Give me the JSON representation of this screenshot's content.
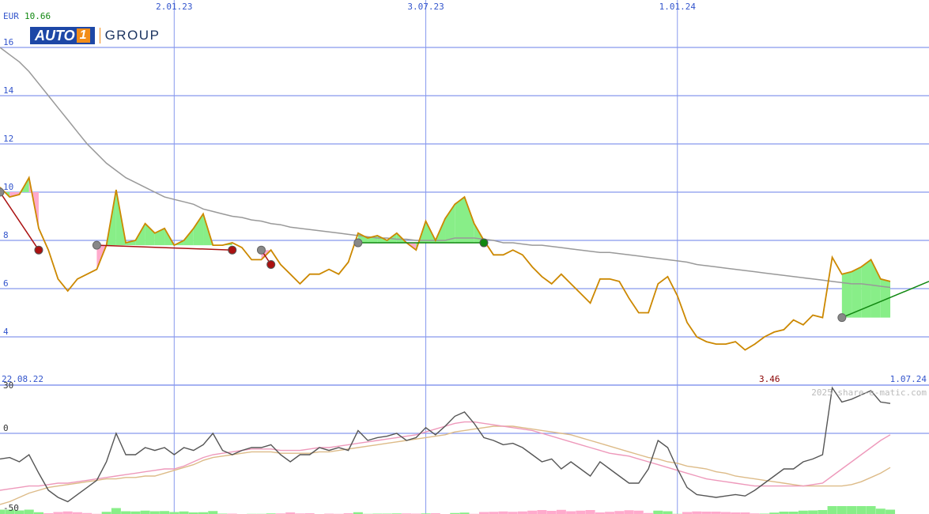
{
  "header": {
    "currency": "EUR",
    "last_price": "10.66"
  },
  "logo": {
    "main": "AUTO",
    "num": "1",
    "group": "GROUP"
  },
  "footer": {
    "start_date": "22.08.22",
    "end_date": "1.07.24",
    "min_label": "3.46",
    "watermark": "2025 share-e-matic.com"
  },
  "colors": {
    "price": "#cc8800",
    "sma": "#999999",
    "grid": "#8899ee",
    "gain": "#88ee88",
    "loss": "#ffaacc",
    "trade_loss": "#aa1111",
    "trade_gain": "#118811",
    "osc": "#555555",
    "osc_sig1": "#ee99bb",
    "osc_sig2": "#ddbb88"
  },
  "chart_data": [
    {
      "type": "line",
      "title": "",
      "ylim": [
        3,
        17
      ],
      "y_ticks": [
        4,
        6,
        8,
        10,
        12,
        14,
        16
      ],
      "x_ticks": [
        {
          "t": 19,
          "label": "2.01.23"
        },
        {
          "t": 45,
          "label": "3.07.23"
        },
        {
          "t": 71,
          "label": "1.01.24"
        }
      ],
      "x_range": [
        1,
        97
      ],
      "grid": true,
      "series": [
        {
          "name": "",
          "role": "price",
          "values": [
            10.2,
            9.8,
            9.9,
            10.6,
            8.5,
            7.6,
            6.4,
            5.9,
            6.4,
            6.6,
            6.8,
            7.8,
            10.1,
            7.9,
            8.0,
            8.7,
            8.3,
            8.5,
            7.8,
            8.0,
            8.5,
            9.1,
            7.8,
            7.8,
            7.9,
            7.7,
            7.2,
            7.2,
            7.6,
            7.0,
            6.6,
            6.2,
            6.6,
            6.6,
            6.8,
            6.6,
            7.1,
            8.3,
            8.1,
            8.2,
            8.0,
            8.3,
            7.9,
            7.6,
            8.8,
            8.0,
            8.9,
            9.5,
            9.8,
            8.7,
            8.0,
            7.4,
            7.4,
            7.6,
            7.4,
            6.9,
            6.5,
            6.2,
            6.6,
            6.2,
            5.8,
            5.4,
            6.4,
            6.4,
            6.3,
            5.6,
            5.0,
            5.0,
            6.2,
            6.5,
            5.7,
            4.6,
            4.0,
            3.8,
            3.7,
            3.7,
            3.8,
            3.46,
            3.7,
            4.0,
            4.2,
            4.3,
            4.7,
            4.5,
            4.9,
            4.8,
            7.3,
            6.6,
            6.7,
            6.9,
            7.2,
            6.4,
            6.3
          ]
        },
        {
          "name": "",
          "role": "sma",
          "values": [
            16.0,
            15.7,
            15.4,
            15.0,
            14.5,
            14.0,
            13.5,
            13.0,
            12.5,
            12.0,
            11.6,
            11.2,
            10.9,
            10.6,
            10.4,
            10.2,
            10.0,
            9.8,
            9.7,
            9.6,
            9.5,
            9.3,
            9.2,
            9.1,
            9.0,
            8.95,
            8.85,
            8.8,
            8.7,
            8.65,
            8.55,
            8.5,
            8.45,
            8.4,
            8.35,
            8.3,
            8.25,
            8.2,
            8.15,
            8.1,
            8.1,
            8.05,
            8.05,
            8.0,
            8.0,
            8.0,
            8.0,
            8.1,
            8.1,
            8.1,
            8.05,
            8.0,
            7.9,
            7.9,
            7.85,
            7.8,
            7.8,
            7.75,
            7.7,
            7.65,
            7.6,
            7.55,
            7.5,
            7.5,
            7.45,
            7.4,
            7.35,
            7.3,
            7.25,
            7.2,
            7.15,
            7.1,
            7.0,
            6.95,
            6.9,
            6.85,
            6.8,
            6.75,
            6.7,
            6.65,
            6.6,
            6.55,
            6.5,
            6.45,
            6.4,
            6.35,
            6.3,
            6.25,
            6.2,
            6.2,
            6.15,
            6.1,
            6.05
          ]
        }
      ],
      "trades": [
        {
          "from": [
            1,
            10.0
          ],
          "to": [
            5,
            7.6
          ],
          "outcome": "loss"
        },
        {
          "from": [
            11,
            7.8
          ],
          "to": [
            25,
            7.6
          ],
          "outcome": "loss"
        },
        {
          "from": [
            28,
            7.6
          ],
          "to": [
            29,
            7.0
          ],
          "outcome": "loss"
        },
        {
          "from": [
            38,
            7.9
          ],
          "to": [
            51,
            7.9
          ],
          "outcome": "gain"
        },
        {
          "from": [
            88,
            4.8
          ],
          "to": [
            97,
            6.3
          ],
          "outcome": "open"
        }
      ]
    },
    {
      "type": "line",
      "title": "",
      "ylim": [
        -52,
        33
      ],
      "y_ticks": [
        -50,
        0,
        30
      ],
      "series": [
        {
          "name": "",
          "role": "oscillator",
          "values": [
            -18,
            -17,
            -20,
            -15,
            -28,
            -40,
            -45,
            -48,
            -43,
            -38,
            -33,
            -20,
            0,
            -15,
            -15,
            -10,
            -12,
            -10,
            -15,
            -10,
            -12,
            -8,
            0,
            -12,
            -15,
            -12,
            -10,
            -10,
            -8,
            -15,
            -20,
            -15,
            -15,
            -10,
            -12,
            -10,
            -12,
            2,
            -5,
            -3,
            -2,
            0,
            -5,
            -3,
            4,
            -1,
            5,
            12,
            15,
            7,
            -3,
            -5,
            -8,
            -7,
            -10,
            -15,
            -20,
            -18,
            -25,
            -20,
            -25,
            -30,
            -20,
            -25,
            -30,
            -35,
            -35,
            -25,
            -5,
            -10,
            -25,
            -38,
            -43,
            -44,
            -45,
            -44,
            -43,
            -44,
            -40,
            -35,
            -30,
            -25,
            -25,
            -20,
            -18,
            -15,
            32,
            22,
            24,
            27,
            30,
            22,
            21
          ]
        },
        {
          "name": "",
          "role": "signal-fast",
          "values": [
            -40,
            -39,
            -38,
            -37,
            -37,
            -36,
            -35,
            -35,
            -34,
            -33,
            -32,
            -31,
            -30,
            -29,
            -28,
            -27,
            -26,
            -25,
            -25,
            -23,
            -20,
            -17,
            -15,
            -14,
            -13,
            -12,
            -11,
            -11,
            -11,
            -12,
            -12,
            -12,
            -11,
            -10,
            -10,
            -9,
            -8,
            -7,
            -6,
            -5,
            -4,
            -3,
            -2,
            -1,
            1,
            3,
            5,
            7,
            8,
            8,
            7,
            6,
            5,
            4,
            3,
            2,
            0,
            -2,
            -4,
            -6,
            -8,
            -10,
            -12,
            -14,
            -15,
            -16,
            -18,
            -20,
            -22,
            -24,
            -26,
            -28,
            -30,
            -32,
            -33,
            -34,
            -35,
            -36,
            -37,
            -37,
            -37,
            -37,
            -37,
            -37,
            -36,
            -35,
            -30,
            -25,
            -20,
            -15,
            -10,
            -5,
            -1
          ]
        },
        {
          "name": "",
          "role": "signal-slow",
          "values": [
            -50,
            -48,
            -45,
            -42,
            -40,
            -38,
            -37,
            -36,
            -35,
            -34,
            -33,
            -32,
            -32,
            -31,
            -31,
            -30,
            -30,
            -28,
            -26,
            -24,
            -22,
            -19,
            -17,
            -16,
            -15,
            -14,
            -13,
            -13,
            -13,
            -14,
            -14,
            -14,
            -14,
            -13,
            -13,
            -12,
            -11,
            -10,
            -9,
            -8,
            -7,
            -6,
            -5,
            -4,
            -3,
            -2,
            -1,
            1,
            2,
            3,
            4,
            5,
            5,
            5,
            4,
            3,
            2,
            1,
            0,
            -1,
            -3,
            -5,
            -7,
            -9,
            -11,
            -13,
            -15,
            -17,
            -18,
            -20,
            -21,
            -23,
            -24,
            -25,
            -27,
            -28,
            -30,
            -31,
            -32,
            -33,
            -34,
            -35,
            -36,
            -37,
            -37,
            -37,
            -37,
            -37,
            -36,
            -34,
            -31,
            -28,
            -24
          ]
        }
      ]
    }
  ]
}
